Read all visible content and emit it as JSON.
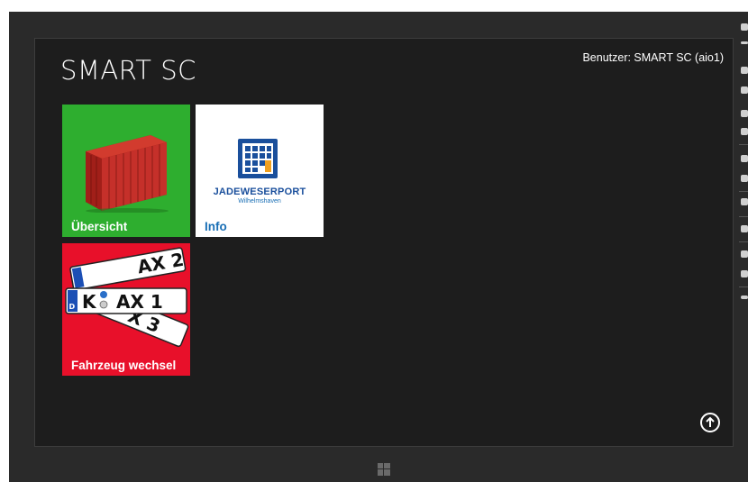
{
  "app": {
    "title": "SMART SC",
    "user_label": "Benutzer: SMART SC (aio1)"
  },
  "tiles": [
    {
      "label": "Übersicht",
      "color": "#2eae2f",
      "icon": "shipping-container-icon"
    },
    {
      "label": "Info",
      "color": "#ffffff",
      "icon": "jadeweserport-logo",
      "logo_text": "JadeWeserPort",
      "logo_subtext": "Wilhelmshaven"
    },
    {
      "label": "Fahrzeug wechsel",
      "color": "#e8102a",
      "icon": "license-plates-icon",
      "plate_texts": [
        "AX 2",
        "K",
        "AX 1",
        "X 3",
        "D"
      ]
    }
  ],
  "controls": {
    "scroll_up_icon": "arrow-up-circle-icon",
    "windows_icon": "windows-logo-icon"
  },
  "colors": {
    "background": "#1d1d1d",
    "bezel": "#2a2a2a",
    "accent_link": "#1a6fb5"
  }
}
